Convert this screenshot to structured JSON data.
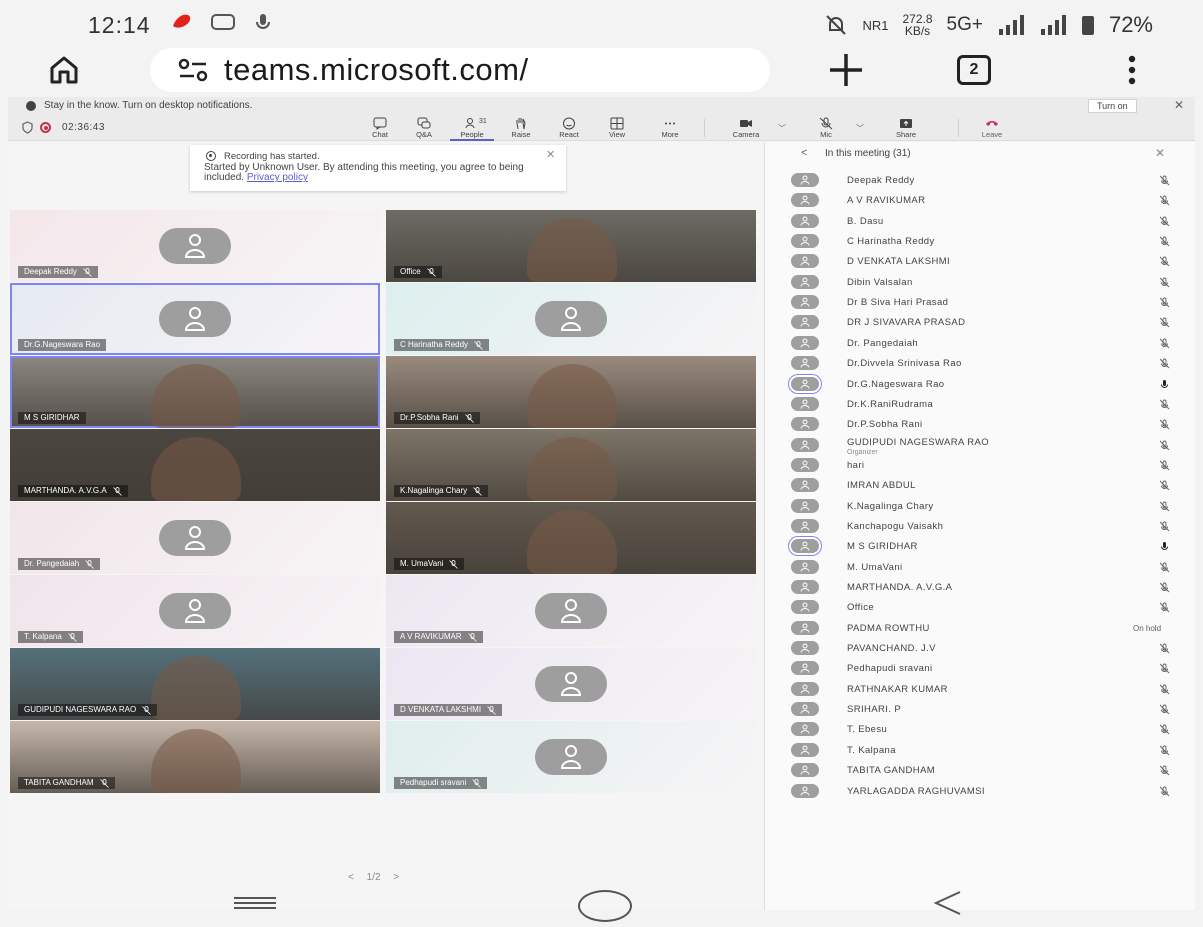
{
  "status_bar": {
    "time": "12:14",
    "network_label": "NR1",
    "speed_value": "272.8",
    "speed_unit": "KB/s",
    "network_type": "5G+",
    "battery": "72%"
  },
  "browser": {
    "url": "teams.microsoft.com/",
    "tab_count": "2"
  },
  "notification": {
    "text": "Stay in the know. Turn on desktop notifications.",
    "turn_on_label": "Turn on"
  },
  "toolbar": {
    "timer": "02:36:43",
    "people_count": "31",
    "buttons": [
      {
        "label": "Chat",
        "icon": "chat-icon"
      },
      {
        "label": "Q&A",
        "icon": "qa-icon"
      },
      {
        "label": "People",
        "icon": "people-icon"
      },
      {
        "label": "Raise",
        "icon": "hand-icon"
      },
      {
        "label": "React",
        "icon": "smiley-icon"
      },
      {
        "label": "View",
        "icon": "grid-icon"
      },
      {
        "label": "More",
        "icon": "more-icon"
      },
      {
        "label": "Camera",
        "icon": "camera-off-icon"
      },
      {
        "label": "Mic",
        "icon": "mic-off-icon"
      },
      {
        "label": "Share",
        "icon": "share-icon"
      },
      {
        "label": "Leave",
        "icon": "phone-icon"
      }
    ]
  },
  "recording_banner": {
    "title": "Recording has started.",
    "body": "Started by Unknown User. By attending this meeting, you agree to being included.",
    "link": "Privacy policy"
  },
  "tiles": [
    {
      "name": "Deepak Reddy",
      "video": false,
      "bg": "#f4e7ea",
      "muted": true
    },
    {
      "name": "Office",
      "video": true,
      "bg": "#6d6b63",
      "muted": true
    },
    {
      "name": "Dr.G.Nageswara Rao",
      "video": false,
      "bg": "#e5eaf1",
      "muted": false,
      "speaking": true
    },
    {
      "name": "C Harinatha Reddy",
      "video": false,
      "bg": "#dcefee",
      "muted": true
    },
    {
      "name": "M S GIRIDHAR",
      "video": true,
      "bg": "#8b8680",
      "muted": false,
      "speaking": true
    },
    {
      "name": "Dr.P.Sobha Rani",
      "video": true,
      "bg": "#9a8a7e",
      "muted": true
    },
    {
      "name": "MARTHANDA. A.V.G.A",
      "video": true,
      "bg": "#4b463f",
      "muted": true
    },
    {
      "name": "K.Nagalinga Chary",
      "video": true,
      "bg": "#7e7568",
      "muted": true
    },
    {
      "name": "Dr. Pangedaiah",
      "video": false,
      "bg": "#f1e6ea",
      "muted": true
    },
    {
      "name": "M. UmaVani",
      "video": true,
      "bg": "#62594f",
      "muted": true
    },
    {
      "name": "T. Kalpana",
      "video": false,
      "bg": "#f0e4ea",
      "muted": true
    },
    {
      "name": "A V RAVIKUMAR",
      "video": false,
      "bg": "#ece8f2",
      "muted": true
    },
    {
      "name": "GUDIPUDI NAGESWARA RAO",
      "video": true,
      "bg": "#55707b",
      "muted": true
    },
    {
      "name": "D VENKATA LAKSHMI",
      "video": false,
      "bg": "#ebe6f2",
      "muted": true
    },
    {
      "name": "TABITA GANDHAM",
      "video": true,
      "bg": "#c7b7ab",
      "muted": true
    },
    {
      "name": "Pedhapudi sravani",
      "video": false,
      "bg": "#dfeeed",
      "muted": true
    }
  ],
  "pager": {
    "text": "1/2"
  },
  "panel": {
    "title": "In this meeting (31)",
    "participants": [
      {
        "name": "Deepak Reddy",
        "mic": "muted"
      },
      {
        "name": "A V RAVIKUMAR",
        "mic": "muted"
      },
      {
        "name": "B. Dasu",
        "mic": "muted"
      },
      {
        "name": "C Harinatha Reddy",
        "mic": "muted"
      },
      {
        "name": "D VENKATA LAKSHMI",
        "mic": "muted"
      },
      {
        "name": "Dibin Valsalan",
        "mic": "muted"
      },
      {
        "name": "Dr B Siva Hari Prasad",
        "mic": "muted"
      },
      {
        "name": "DR J SIVAVARA PRASAD",
        "mic": "muted"
      },
      {
        "name": "Dr. Pangedaiah",
        "mic": "muted"
      },
      {
        "name": "Dr.Divvela Srinivasa Rao",
        "mic": "muted"
      },
      {
        "name": "Dr.G.Nageswara Rao",
        "mic": "on",
        "speaking": true
      },
      {
        "name": "Dr.K.RaniRudrama",
        "mic": "muted"
      },
      {
        "name": "Dr.P.Sobha Rani",
        "mic": "muted"
      },
      {
        "name": "GUDIPUDI NAGESWARA RAO",
        "role": "Organizer",
        "mic": "muted"
      },
      {
        "name": "hari",
        "mic": "muted"
      },
      {
        "name": "IMRAN ABDUL",
        "mic": "muted"
      },
      {
        "name": "K.Nagalinga Chary",
        "mic": "muted"
      },
      {
        "name": "Kanchapogu Vaisakh",
        "mic": "muted"
      },
      {
        "name": "M S GIRIDHAR",
        "mic": "on",
        "speaking": true
      },
      {
        "name": "M. UmaVani",
        "mic": "muted"
      },
      {
        "name": "MARTHANDA. A.V.G.A",
        "mic": "muted"
      },
      {
        "name": "Office",
        "mic": "muted"
      },
      {
        "name": "PADMA ROWTHU",
        "status": "On hold"
      },
      {
        "name": "PAVANCHAND. J.V",
        "mic": "muted"
      },
      {
        "name": "Pedhapudi sravani",
        "mic": "muted"
      },
      {
        "name": "RATHNAKAR KUMAR",
        "mic": "muted"
      },
      {
        "name": "SRIHARI. P",
        "mic": "muted"
      },
      {
        "name": "T. Ebesu",
        "mic": "muted"
      },
      {
        "name": "T. Kalpana",
        "mic": "muted"
      },
      {
        "name": "TABITA GANDHAM",
        "mic": "muted"
      },
      {
        "name": "YARLAGADDA RAGHUVAMSI",
        "mic": "muted"
      }
    ]
  },
  "colors": {
    "accent": "#5b5fc7",
    "recording": "#c4314b",
    "avatar": "#9e9e9e"
  }
}
